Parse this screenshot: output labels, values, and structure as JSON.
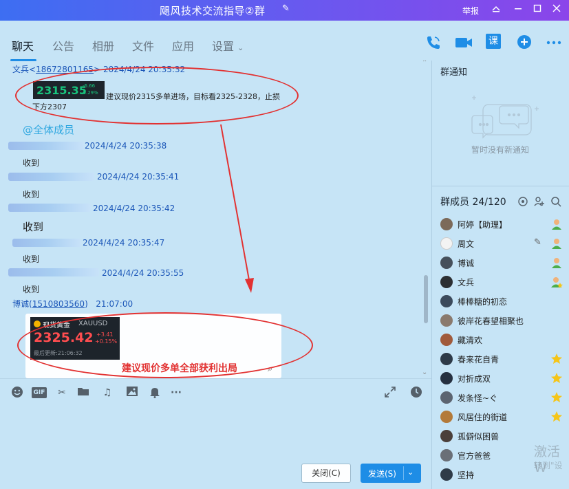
{
  "window": {
    "title": "飓风技术交流指导②群",
    "report": "举报"
  },
  "tabs": [
    "聊天",
    "公告",
    "相册",
    "文件",
    "应用",
    "设置"
  ],
  "header_icons": [
    "phone-icon",
    "video-icon",
    "class-icon",
    "add-icon",
    "more-icon"
  ],
  "header_class_label": "课",
  "messages": {
    "m1": {
      "sender": "文兵",
      "sender_link": "18672801165",
      "time": "2024/4/24 20:35:32",
      "ticker_price": "2315.35",
      "ticker_change": "-6.66",
      "ticker_pct": "-0.29%",
      "text1": "建议现价2315多单进场，目标看2325-2328，止损",
      "text2": "下方2307"
    },
    "mention": "@全体成员",
    "m2": {
      "time": "2024/4/24 20:35:38",
      "text": "收到"
    },
    "m3": {
      "time": "2024/4/24 20:35:41",
      "text": "收到"
    },
    "m4": {
      "time": "2024/4/24 20:35:42",
      "text": "收到"
    },
    "m5": {
      "time": "2024/4/24 20:35:47",
      "text": "收到"
    },
    "m6": {
      "time": "2024/4/24 20:35:55",
      "text": "收到"
    },
    "m7": {
      "sender": "博诚",
      "sender_link": "1510803560",
      "time": "21:07:00",
      "card_title": "现货黄金",
      "card_symbol": "XAUUSD",
      "card_price": "2325.42",
      "card_change": "+3.41",
      "card_pct": "+0.15%",
      "card_update": "最后更新:21:06:32",
      "overlay": "建议现价多单全部获利出局"
    }
  },
  "toolbar_icons": [
    "emoji-icon",
    "gif-icon",
    "scissors-icon",
    "folder-icon",
    "music-icon",
    "image-icon",
    "bell-icon",
    "more-icon",
    "expand-icon",
    "history-icon"
  ],
  "toolbar_gif_label": "GIF",
  "buttons": {
    "close": "关闭(C)",
    "send": "发送(S)"
  },
  "sidebar": {
    "notice_title": "群通知",
    "notice_empty": "暂时没有新通知",
    "members_title": "群成员 24/120",
    "members": [
      {
        "name": "阿婷【助理】",
        "badge": "admin-icon"
      },
      {
        "name": "周文",
        "badge": "admin-icon"
      },
      {
        "name": "博诚",
        "badge": "admin-icon"
      },
      {
        "name": "文兵",
        "badge": "owner-icon"
      },
      {
        "name": "棒棒糖的初恋",
        "badge": ""
      },
      {
        "name": "彼岸花春望相聚也",
        "badge": ""
      },
      {
        "name": "藏清欢",
        "badge": ""
      },
      {
        "name": "春来花自青",
        "badge": "star-icon"
      },
      {
        "name": "对折成双",
        "badge": "star-icon"
      },
      {
        "name": "发条怪~ぐ",
        "badge": "star-icon"
      },
      {
        "name": "风居住的街道",
        "badge": "star-icon"
      },
      {
        "name": "孤僻似困兽",
        "badge": ""
      },
      {
        "name": "官方爸爸",
        "badge": ""
      },
      {
        "name": "坚持",
        "badge": ""
      }
    ]
  },
  "watermark": {
    "line1": "激活 W",
    "line2": "转到\"设"
  },
  "colors": {
    "accent": "#1e8de6",
    "title_gradient_start": "#3d6ef2",
    "title_gradient_end": "#8b45ea",
    "annotation_red": "#e23232",
    "price_down": "#19c37d",
    "price_up": "#ff4d4f"
  }
}
